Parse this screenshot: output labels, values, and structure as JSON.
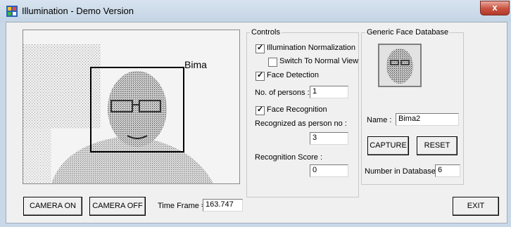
{
  "window": {
    "title": "Illumination - Demo Version",
    "close_label": "x"
  },
  "preview": {
    "face_label": "Bima"
  },
  "controls": {
    "group_label": "Controls",
    "illumination_normalization": {
      "label": "Illumination Normalization",
      "checked": true
    },
    "switch_normal_view": {
      "label": "Switch To Normal View",
      "checked": false
    },
    "face_detection": {
      "label": "Face Detection",
      "checked": true
    },
    "persons_label": "No. of persons :",
    "persons_value": "1",
    "face_recognition": {
      "label": "Face Recognition",
      "checked": true
    },
    "recognized_label": "Recognized as person no :",
    "recognized_value": "3",
    "score_label": "Recognition Score :",
    "score_value": "0"
  },
  "database": {
    "group_label": "Generic Face Database",
    "name_label": "Name :",
    "name_value": "Bima2",
    "capture_label": "CAPTURE",
    "reset_label": "RESET",
    "count_label": "Number in Database :",
    "count_value": "6"
  },
  "bottom": {
    "camera_on_label": "CAMERA ON",
    "camera_off_label": "CAMERA OFF",
    "time_frame_label": "Time Frame =",
    "time_frame_value": "163.747",
    "exit_label": "EXIT"
  }
}
